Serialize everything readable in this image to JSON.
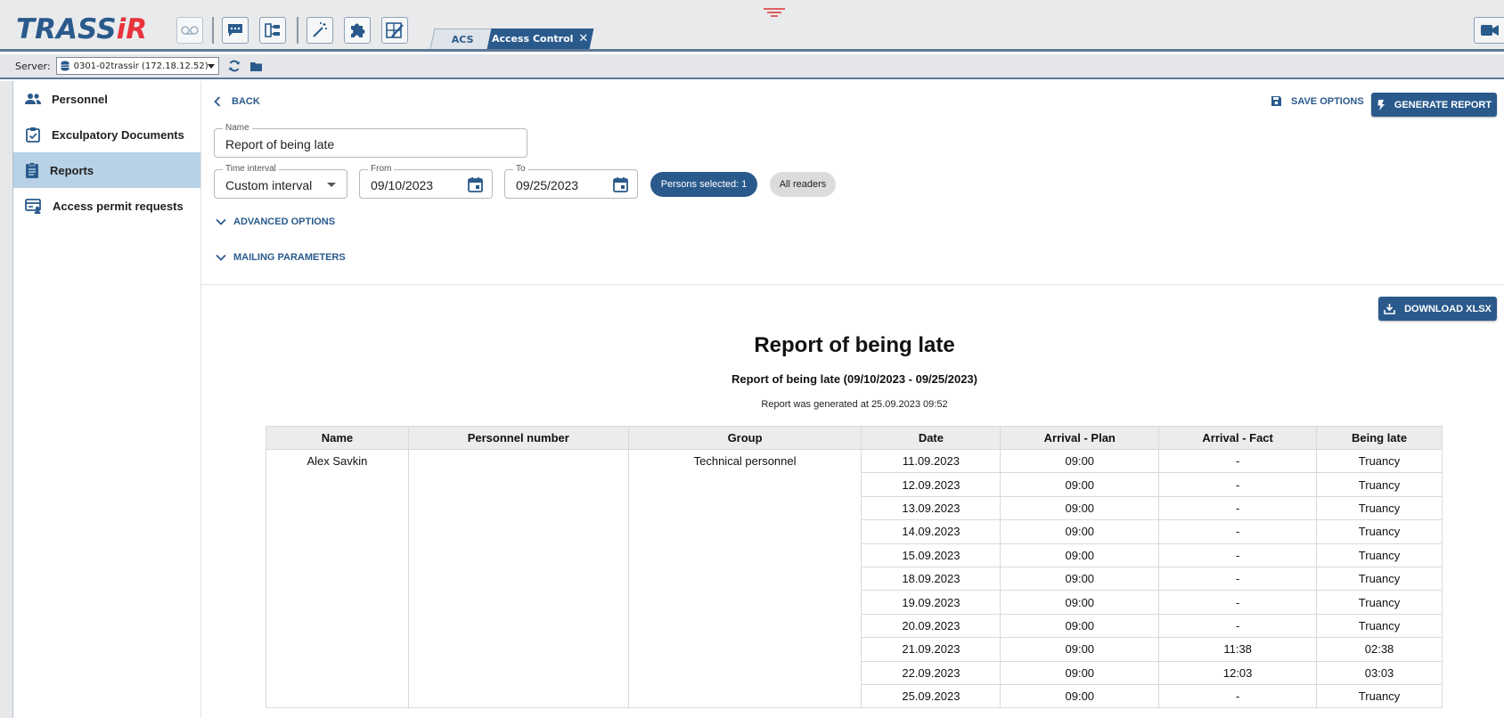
{
  "app": {
    "logo_left": "TRASS",
    "logo_accent": "iR",
    "brand_color": "#2a5a8c",
    "accent_color": "#e8333a"
  },
  "toolbar": {
    "icons": [
      "voicemail-icon",
      "chat-icon",
      "org-tree-icon",
      "magic-wand-icon",
      "puzzle-icon",
      "layout-edit-icon"
    ],
    "camera_icon": "video-camera-icon"
  },
  "tabs": [
    {
      "label": "ACS"
    },
    {
      "label": "Access Control",
      "close": "✕"
    }
  ],
  "server": {
    "label": "Server:",
    "value": "0301-02trassir (172.18.12.52)"
  },
  "sidebar": {
    "items": [
      {
        "label": "Personnel",
        "icon": "people-icon"
      },
      {
        "label": "Exculpatory Documents",
        "icon": "clipboard-check-icon"
      },
      {
        "label": "Reports",
        "icon": "report-icon",
        "active": true
      },
      {
        "label": "Access permit requests",
        "icon": "permit-card-icon"
      }
    ]
  },
  "header": {
    "back_label": "BACK",
    "save_options_label": "SAVE OPTIONS",
    "generate_report_label": "GENERATE REPORT"
  },
  "form": {
    "name_label": "Name",
    "name_value": "Report of being late",
    "time_interval_label": "Time interval",
    "time_interval_value": "Custom interval",
    "from_label": "From",
    "from_value": "09/10/2023",
    "to_label": "To",
    "to_value": "09/25/2023",
    "persons_chip": "Persons selected: 1",
    "readers_chip": "All readers",
    "advanced_options_label": "ADVANCED OPTIONS",
    "mailing_parameters_label": "MAILING PARAMETERS"
  },
  "report": {
    "download_label": "DOWNLOAD XLSX",
    "title": "Report of being late",
    "subtitle": "Report of being late (09/10/2023 - 09/25/2023)",
    "generated_at": "Report was generated at 25.09.2023 09:52",
    "columns": [
      "Name",
      "Personnel number",
      "Group",
      "Date",
      "Arrival - Plan",
      "Arrival - Fact",
      "Being late"
    ],
    "person": {
      "name": "Alex Savkin",
      "personnel_number": "",
      "group": "Technical personnel"
    },
    "rows": [
      {
        "date": "11.09.2023",
        "plan": "09:00",
        "fact": "-",
        "late": "Truancy"
      },
      {
        "date": "12.09.2023",
        "plan": "09:00",
        "fact": "-",
        "late": "Truancy"
      },
      {
        "date": "13.09.2023",
        "plan": "09:00",
        "fact": "-",
        "late": "Truancy"
      },
      {
        "date": "14.09.2023",
        "plan": "09:00",
        "fact": "-",
        "late": "Truancy"
      },
      {
        "date": "15.09.2023",
        "plan": "09:00",
        "fact": "-",
        "late": "Truancy"
      },
      {
        "date": "18.09.2023",
        "plan": "09:00",
        "fact": "-",
        "late": "Truancy"
      },
      {
        "date": "19.09.2023",
        "plan": "09:00",
        "fact": "-",
        "late": "Truancy"
      },
      {
        "date": "20.09.2023",
        "plan": "09:00",
        "fact": "-",
        "late": "Truancy"
      },
      {
        "date": "21.09.2023",
        "plan": "09:00",
        "fact": "11:38",
        "late": "02:38"
      },
      {
        "date": "22.09.2023",
        "plan": "09:00",
        "fact": "12:03",
        "late": "03:03"
      },
      {
        "date": "25.09.2023",
        "plan": "09:00",
        "fact": "-",
        "late": "Truancy"
      }
    ]
  }
}
